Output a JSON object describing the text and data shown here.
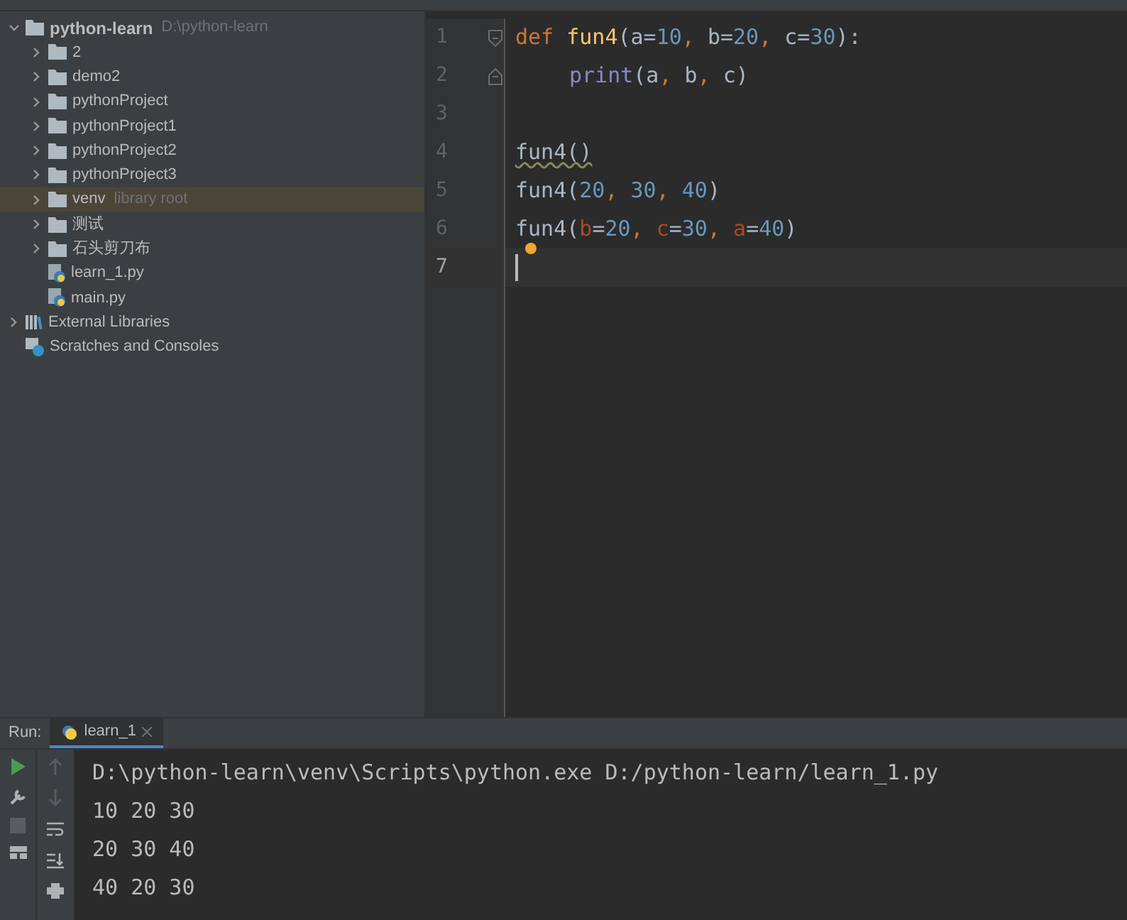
{
  "project_tree": [
    {
      "kind": "folder",
      "label": "python-learn",
      "hint": "D:\\python-learn",
      "bold": true,
      "expanded": true,
      "selected": false,
      "children": [
        {
          "kind": "folder",
          "label": "2",
          "expanded": false,
          "selected": false
        },
        {
          "kind": "folder",
          "label": "demo2",
          "expanded": false,
          "selected": false
        },
        {
          "kind": "folder",
          "label": "pythonProject",
          "expanded": false,
          "selected": false
        },
        {
          "kind": "folder",
          "label": "pythonProject1",
          "expanded": false,
          "selected": false
        },
        {
          "kind": "folder",
          "label": "pythonProject2",
          "expanded": false,
          "selected": false
        },
        {
          "kind": "folder",
          "label": "pythonProject3",
          "expanded": false,
          "selected": false
        },
        {
          "kind": "folder",
          "label": "venv",
          "hint": "library root",
          "expanded": false,
          "selected": true
        },
        {
          "kind": "folder",
          "label": "测试",
          "expanded": false,
          "selected": false
        },
        {
          "kind": "folder",
          "label": "石头剪刀布",
          "expanded": false,
          "selected": false
        },
        {
          "kind": "python",
          "label": "learn_1.py",
          "selected": false
        },
        {
          "kind": "python",
          "label": "main.py",
          "selected": false
        }
      ]
    },
    {
      "kind": "libraries",
      "label": "External Libraries",
      "expanded": false,
      "selected": false
    },
    {
      "kind": "scratches",
      "label": "Scratches and Consoles",
      "selected": false
    }
  ],
  "editor": {
    "lines": [
      {
        "number": "1",
        "current": false,
        "fold": {
          "kind": "start"
        },
        "tokens": [
          {
            "kind": "keyword",
            "text": "def "
          },
          {
            "kind": "func",
            "text": "fun4"
          },
          {
            "kind": "plain",
            "text": "(a="
          },
          {
            "kind": "number",
            "text": "10"
          },
          {
            "kind": "punct",
            "text": ", "
          },
          {
            "kind": "plain",
            "text": "b="
          },
          {
            "kind": "number",
            "text": "20"
          },
          {
            "kind": "punct",
            "text": ", "
          },
          {
            "kind": "plain",
            "text": "c="
          },
          {
            "kind": "number",
            "text": "30"
          },
          {
            "kind": "plain",
            "text": "):"
          }
        ]
      },
      {
        "number": "2",
        "current": false,
        "indented": true,
        "fold": {
          "kind": "end"
        },
        "tokens": [
          {
            "kind": "builtin",
            "text": "print"
          },
          {
            "kind": "plain",
            "text": "(a"
          },
          {
            "kind": "punct",
            "text": ", "
          },
          {
            "kind": "plain",
            "text": "b"
          },
          {
            "kind": "punct",
            "text": ", "
          },
          {
            "kind": "plain",
            "text": "c)"
          }
        ]
      },
      {
        "number": "3",
        "current": false
      },
      {
        "number": "4",
        "current": false,
        "tokens": [
          {
            "kind": "warning",
            "text": "fun4()"
          }
        ]
      },
      {
        "number": "5",
        "current": false,
        "tokens": [
          {
            "kind": "plain",
            "text": "fun4("
          },
          {
            "kind": "number",
            "text": "20"
          },
          {
            "kind": "punct",
            "text": ", "
          },
          {
            "kind": "number",
            "text": "30"
          },
          {
            "kind": "punct",
            "text": ", "
          },
          {
            "kind": "number",
            "text": "40"
          },
          {
            "kind": "plain",
            "text": ")"
          }
        ]
      },
      {
        "number": "6",
        "current": false,
        "bulb": true,
        "tokens": [
          {
            "kind": "plain",
            "text": "fun4("
          },
          {
            "kind": "named",
            "text": "b"
          },
          {
            "kind": "plain",
            "text": "="
          },
          {
            "kind": "number",
            "text": "20"
          },
          {
            "kind": "punct",
            "text": ", "
          },
          {
            "kind": "named",
            "text": "c"
          },
          {
            "kind": "plain",
            "text": "="
          },
          {
            "kind": "number",
            "text": "30"
          },
          {
            "kind": "punct",
            "text": ", "
          },
          {
            "kind": "named",
            "text": "a"
          },
          {
            "kind": "plain",
            "text": "="
          },
          {
            "kind": "number",
            "text": "40"
          },
          {
            "kind": "plain",
            "text": ")"
          }
        ]
      },
      {
        "number": "7",
        "current": true
      }
    ]
  },
  "run_panel": {
    "title": "Run:",
    "tabs": [
      {
        "label": "learn_1",
        "selected": true
      }
    ],
    "output": [
      "D:\\python-learn\\venv\\Scripts\\python.exe D:/python-learn/learn_1.py",
      "10 20 30",
      "20 30 40",
      "40 20 30"
    ]
  }
}
